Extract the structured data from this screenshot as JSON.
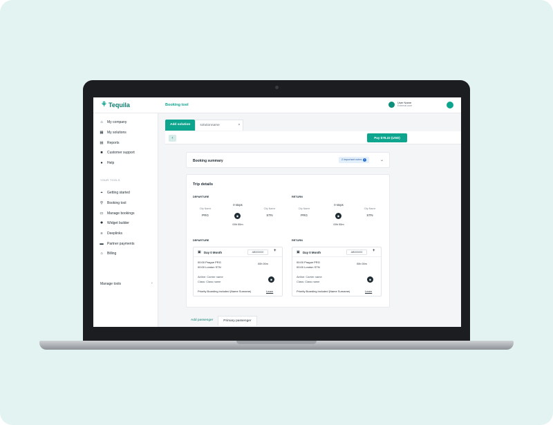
{
  "app": {
    "name": "Tequila",
    "page_title": "Booking tool"
  },
  "user": {
    "name": "User Name",
    "role": "External user"
  },
  "sidebar": {
    "items": [
      {
        "label": "My company",
        "icon": "store-icon"
      },
      {
        "label": "My solutions",
        "icon": "grid-icon"
      },
      {
        "label": "Reports",
        "icon": "chart-icon"
      },
      {
        "label": "Customer support",
        "icon": "chat-icon"
      },
      {
        "label": "Help",
        "icon": "help-icon"
      }
    ],
    "tools_title": "YOUR TOOLS",
    "tools": [
      {
        "label": "Getting started",
        "icon": "pin-icon"
      },
      {
        "label": "Booking tool",
        "icon": "search-icon"
      },
      {
        "label": "Manage bookings",
        "icon": "calendar-icon"
      },
      {
        "label": "Widget builder",
        "icon": "gear-icon"
      },
      {
        "label": "Deeplinks",
        "icon": "list-icon"
      },
      {
        "label": "Partner payments",
        "icon": "card-icon"
      },
      {
        "label": "Billing",
        "icon": "bank-icon"
      }
    ],
    "manage_tools": "Manage tools"
  },
  "tabs": {
    "add": "Add solution",
    "solution_name": "solutionname",
    "close": "×"
  },
  "toolbar": {
    "back": "‹",
    "pay": "Pay $78.22 (USD)"
  },
  "summary": {
    "title": "Booking summary",
    "badge": "2 important notes",
    "badge_icon": "i"
  },
  "trip": {
    "title": "Trip details",
    "departure": {
      "label": "DEPARTURE",
      "from_label": "City Name",
      "from": "PRG",
      "stops": "0 stops",
      "to_label": "City Name",
      "to": "STN",
      "duration": "00h 00m"
    },
    "return": {
      "label": "RETURN",
      "from_label": "City Name",
      "from": "PRG",
      "stops": "0 stops",
      "to_label": "City Name",
      "to": "STN",
      "duration": "00h 00m"
    },
    "legs": [
      {
        "label": "DEPARTURE",
        "day": "Day 0 Month",
        "code": "AB000000",
        "dep": "00:00 Prague PRG",
        "arr": "00:00 London STN",
        "duration": "00h 00m",
        "airline": "Airline: Carrier name",
        "class": "Class: Class name",
        "extra": "Priority Boarding included (Name Surname)",
        "learn": "Learn"
      },
      {
        "label": "RETURN",
        "day": "Day 0 Month",
        "code": "AB000000",
        "dep": "00:00 Prague PRG",
        "arr": "00:00 London STN",
        "duration": "00h 00m",
        "airline": "Airline: Carrier name",
        "class": "Class: Class name",
        "extra": "Priority Boarding included (Name Surname)",
        "learn": "Learn"
      }
    ]
  },
  "passenger_tabs": {
    "add": "Add passenger",
    "primary": "Primary passenger"
  },
  "colors": {
    "accent": "#0ea58f",
    "dark": "#1f2b33",
    "background": "#e3f3f1"
  }
}
